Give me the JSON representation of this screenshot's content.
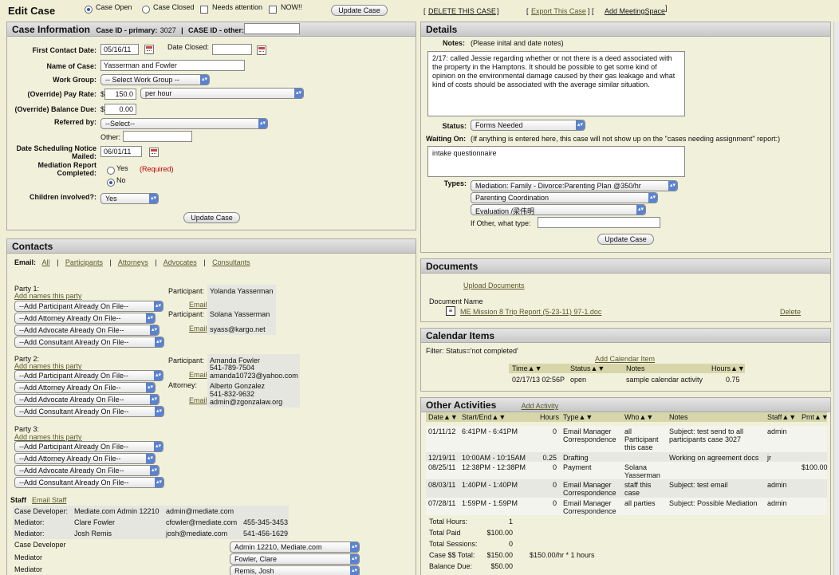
{
  "header": {
    "title": "Edit Case",
    "opt_open": "Case Open",
    "opt_closed": "Case Closed",
    "opt_needs_attention": "Needs attention",
    "opt_now": "NOW!!",
    "update_button": "Update Case",
    "delete_link": "DELETE THIS CASE",
    "export_link": "Export This Case",
    "meetingspace_link": "Add MeetingSpace",
    "bracket_open": "[",
    "bracket_close": "]",
    "pipe_bracket": "] ["
  },
  "case_info": {
    "title": "Case Information",
    "case_id_label": "Case ID - primary:",
    "case_id": "3027",
    "case_id_other_label": "CASE ID - other:",
    "first_contact_label": "First Contact Date:",
    "first_contact": "05/16/11",
    "date_closed_label": "Date Closed:",
    "date_closed": "",
    "name_label": "Name of Case:",
    "name": "Yasserman and Fowler",
    "workgroup_label": "Work Group:",
    "workgroup": "-- Select Work Group --",
    "payrate_label": "(Override) Pay Rate:",
    "currency": "$",
    "payrate": "150.0",
    "payrate_unit": "per hour",
    "balance_label": "(Override) Balance Due:",
    "balance": "0.00",
    "referred_label": "Referred by:",
    "referred": "--Select--",
    "other_label": "Other:",
    "notice_label": "Date Scheduling Notice Mailed:",
    "notice_date": "06/01/11",
    "mediation_label": "Mediation Report Completed:",
    "yes": "Yes",
    "no": "No",
    "required": "(Required)",
    "children_label": "Children involved?:",
    "children": "Yes",
    "update_button": "Update Case"
  },
  "details": {
    "title": "Details",
    "notes_label": "Notes:",
    "notes_hint": "(Please inital and date notes)",
    "notes": "2/17: called Jessie regarding whether or not there is a deed associated with the property in the Hamptons. It should be possible to get some kind of opinion on the environmental damage caused by their gas leakage and what kind of costs should be associated with the average similar situation.",
    "status_label": "Status:",
    "status": "Forms Needed",
    "waiting_label": "Waiting On:",
    "waiting_hint": "(If anything is entered here, this case will not show up on the \"cases needing assignment\" report:)",
    "waiting": "intake questionnaire",
    "types_label": "Types:",
    "types": [
      "Mediation: Family - Divorce:Parenting Plan @350/hr",
      "Parenting Coordination",
      "Evaluation /梁伟明"
    ],
    "other_type_label": "If Other, what type:",
    "update_button": "Update Case"
  },
  "contacts": {
    "title": "Contacts",
    "email_label": "Email:",
    "filters": [
      "All",
      "Participants",
      "Attorneys",
      "Advocates",
      "Consultants"
    ],
    "sep": "|",
    "add_names": "Add names this party",
    "add_participant": "--Add Participant Already On File--",
    "add_attorney": "--Add Attorney Already On File--",
    "add_advocate": "--Add Advocate Already On File--",
    "add_consultant": "--Add Consultant Already On File--",
    "party1": "Party 1:",
    "party2": "Party 2:",
    "party3": "Party 3:",
    "participant_label": "Participant:",
    "attorney_label": "Attorney:",
    "email_link": "Email",
    "p1_a_name": "Yolanda Yasserman",
    "p1_b_name": "Solana Yasserman",
    "p1_b_email": "syass@kargo.net",
    "p2_a_name": "Amanda Fowler",
    "p2_a_phone": "541-789-7504",
    "p2_a_email": "amanda10723@yahoo.com",
    "p2_b_name": "Alberto Gonzalez",
    "p2_b_phone": "541-832-9632",
    "p2_b_email": "admin@zgonzalaw.org",
    "staff_label": "Staff",
    "email_staff": "Email Staff",
    "staff": [
      {
        "role": "Case Developer:",
        "name": "Mediate.com Admin 12210",
        "email": "admin@mediate.com",
        "phone": ""
      },
      {
        "role": "Mediator:",
        "name": "Clare Fowler",
        "email": "cfowler@mediate.com",
        "phone": "455-345-3453"
      },
      {
        "role": "Mediator:",
        "name": "Josh Remis",
        "email": "josh@mediate.com",
        "phone": "541-456-1629"
      }
    ],
    "assign": [
      {
        "role": "Case Developer",
        "value": "Admin 12210, Mediate.com"
      },
      {
        "role": "Mediator",
        "value": "Fowler, Clare"
      },
      {
        "role": "Mediator",
        "value": "Remis, Josh"
      }
    ]
  },
  "documents": {
    "title": "Documents",
    "upload": "Upload Documents",
    "col": "Document Name",
    "file": "ME Mission 8 Trip Report (5-23-11) 97-1.doc",
    "delete": "Delete"
  },
  "calendar": {
    "title": "Calendar Items",
    "filter": "Filter: Status='not completed'",
    "add": "Add Calendar Item",
    "cols": [
      "Time▲▼",
      "Status▲▼",
      "Notes",
      "Hours▲▼"
    ],
    "row": [
      "02/17/13 02:56P",
      "open",
      "sample calendar activity",
      "0.75"
    ]
  },
  "activities": {
    "title": "Other Activities",
    "add": "Add Activity",
    "cols": [
      "Date▲▼",
      "Start/End▲▼",
      "Hours",
      "Type▲▼",
      "Who▲▼",
      "Notes",
      "Staff▲▼",
      "Pmt▲▼"
    ],
    "rows": [
      [
        "01/11/12",
        "6:41PM - 6:41PM",
        "0",
        "Email Manager Correspondence",
        "all Participant this case",
        "Subject: test send to all participants case 3027",
        "admin",
        ""
      ],
      [
        "12/19/11",
        "10:00AM - 10:15AM",
        "0.25",
        "Drafting",
        "",
        "Working on agreement docs",
        "jr",
        ""
      ],
      [
        "08/25/11",
        "12:38PM - 12:38PM",
        "0",
        "Payment",
        "Solana Yasserman",
        "",
        "",
        "$100.00"
      ],
      [
        "08/03/11",
        "1:40PM - 1:40PM",
        "0",
        "Email Manager Correspondence",
        "staff this case",
        "Subject: test email",
        "admin",
        ""
      ],
      [
        "07/28/11",
        "1:59PM - 1:59PM",
        "0",
        "Email Manager Correspondence",
        "all parties",
        "Subject: Possible Mediation",
        "admin",
        ""
      ]
    ],
    "totals": [
      {
        "label": "Total Hours:",
        "value": "1",
        "extra": ""
      },
      {
        "label": "Total Paid",
        "value": "$100.00",
        "extra": ""
      },
      {
        "label": "Total Sessions:",
        "value": "0",
        "extra": ""
      },
      {
        "label": "Case $$ Total:",
        "value": "$150.00",
        "extra": "$150.00/hr * 1 hours"
      },
      {
        "label": "Balance Due:",
        "value": "$50.00",
        "extra": ""
      }
    ]
  }
}
